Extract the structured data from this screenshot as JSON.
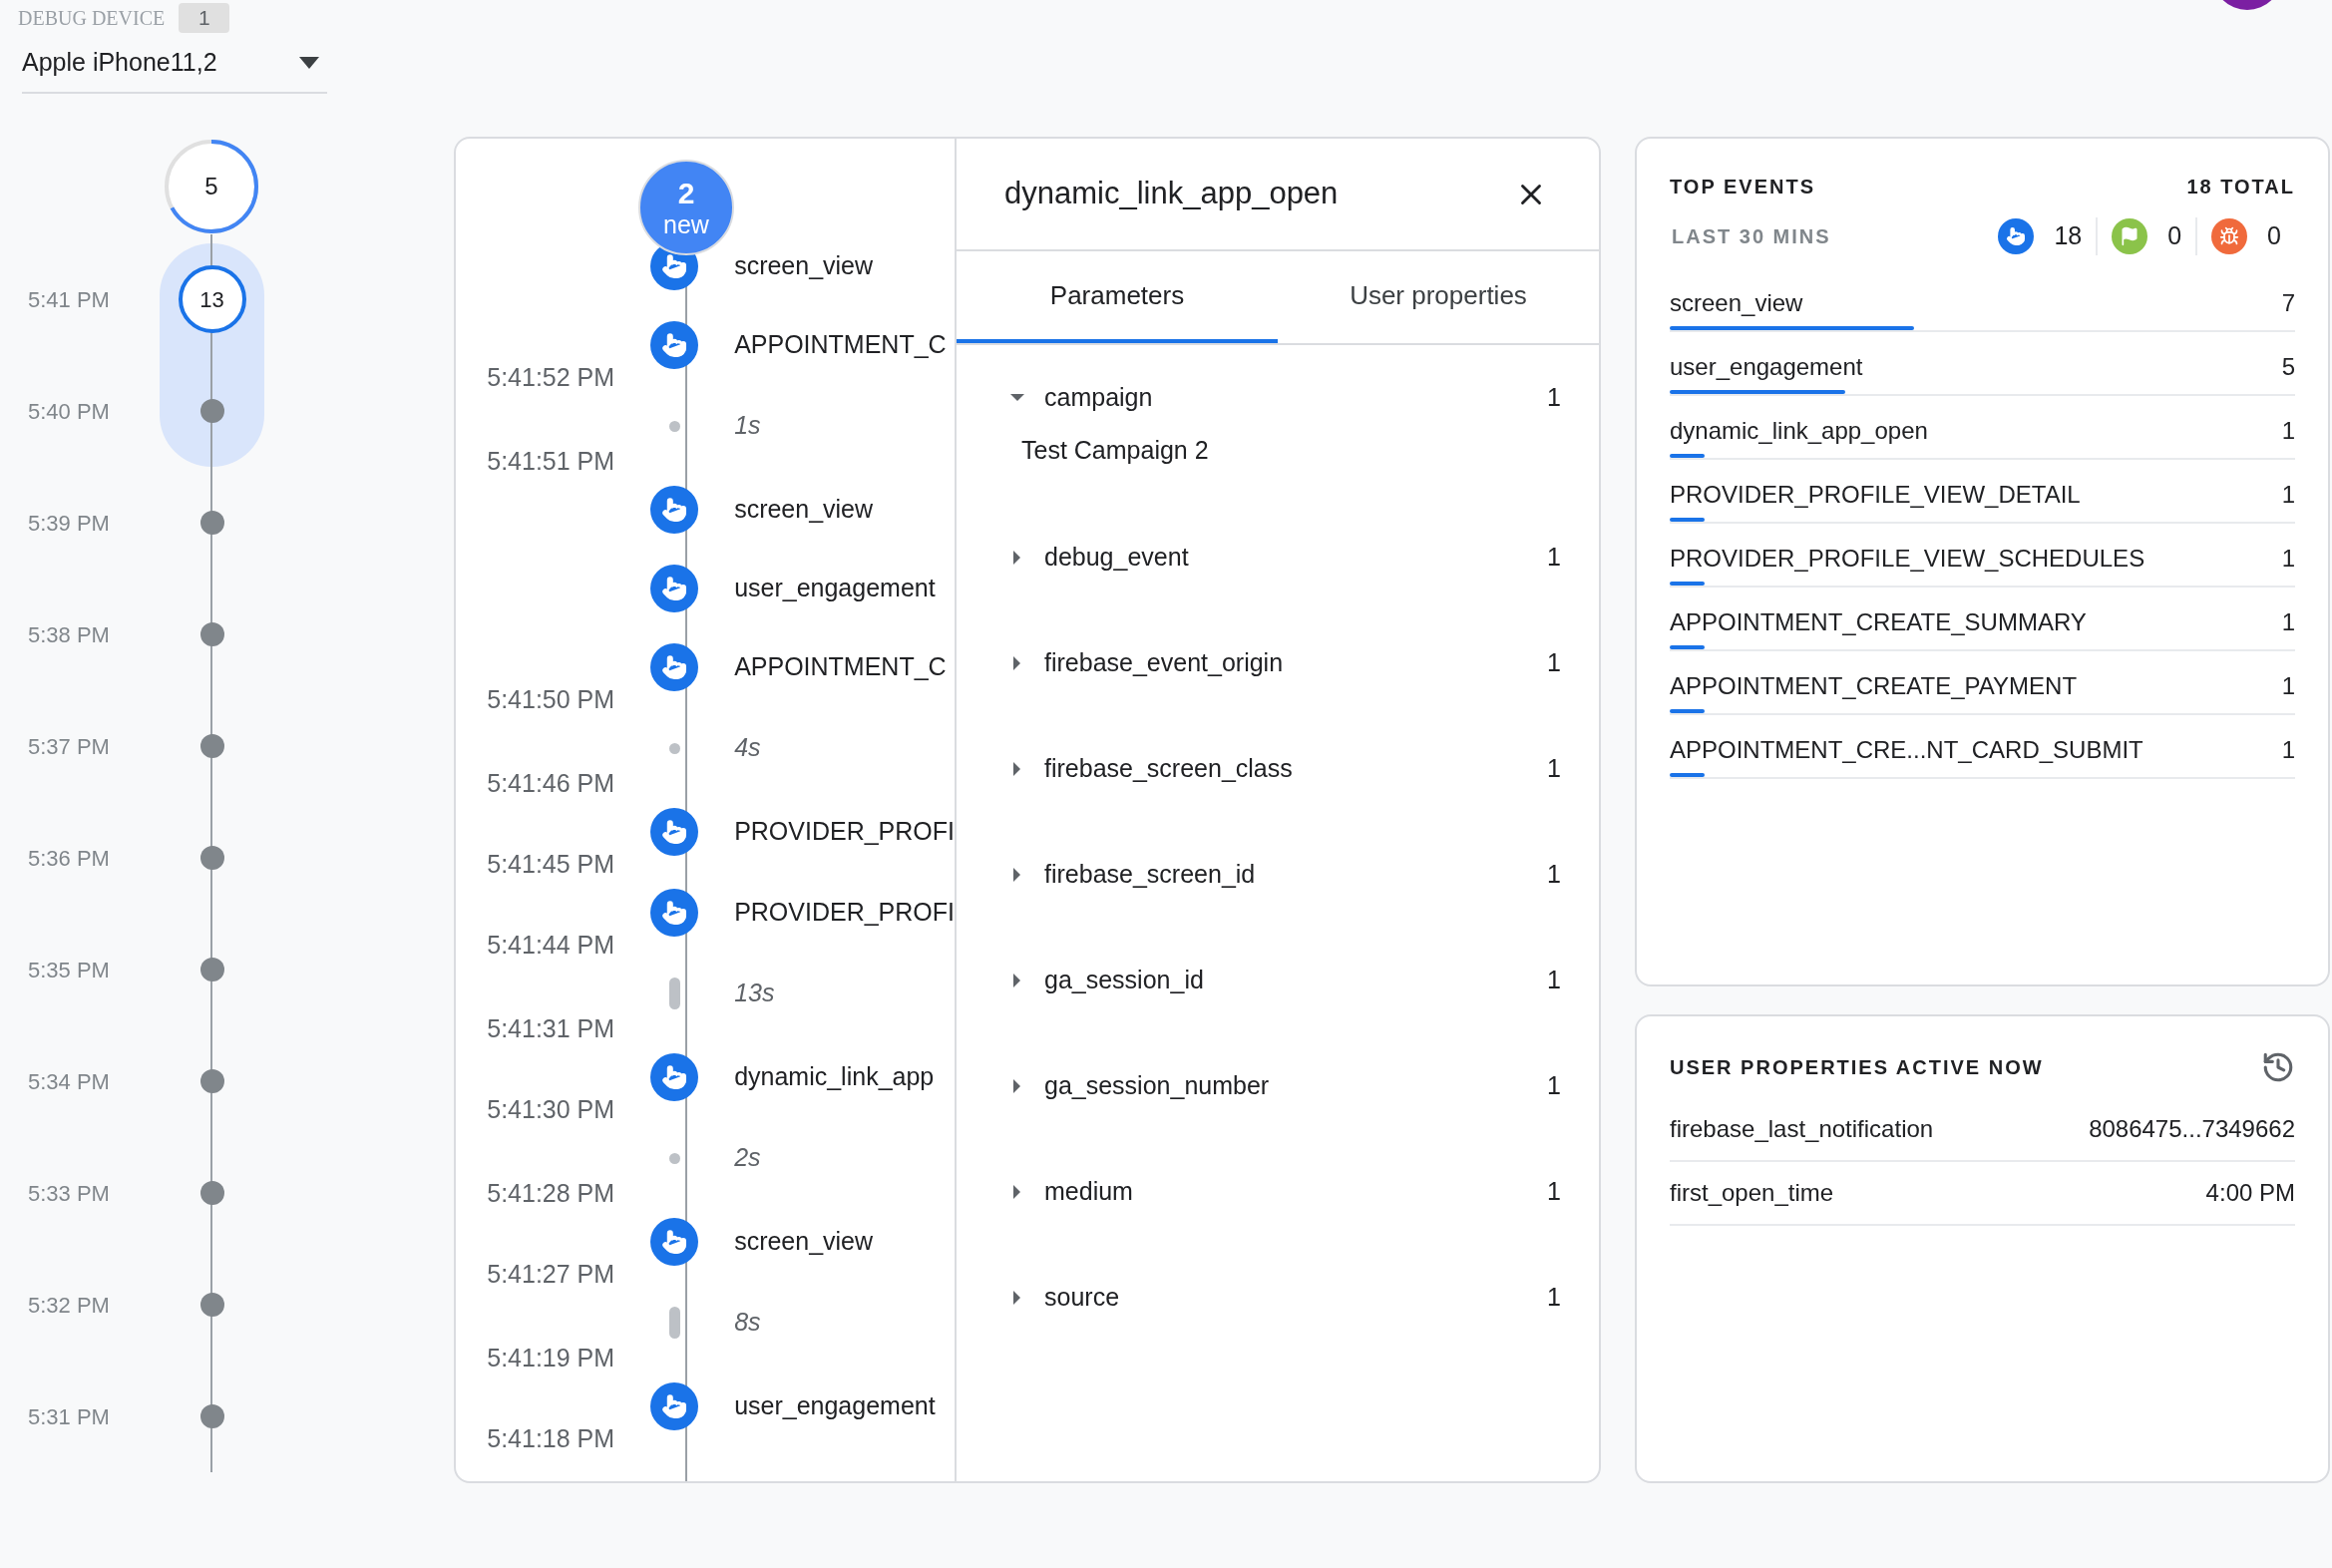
{
  "debug_device": {
    "label": "DEBUG DEVICE",
    "count": "1",
    "device": "Apple iPhone11,2"
  },
  "timeline": {
    "pending": {
      "count": "5",
      "level": 0.67
    },
    "minutes": [
      {
        "time": "5:41 PM",
        "kind": "count",
        "count": "13",
        "in_range": true
      },
      {
        "time": "5:40 PM",
        "kind": "dot",
        "in_range": true
      },
      {
        "time": "5:39 PM",
        "kind": "dot",
        "in_range": false
      },
      {
        "time": "5:38 PM",
        "kind": "dot",
        "in_range": false
      },
      {
        "time": "5:37 PM",
        "kind": "dot",
        "in_range": false
      },
      {
        "time": "5:36 PM",
        "kind": "dot",
        "in_range": false
      },
      {
        "time": "5:35 PM",
        "kind": "dot",
        "in_range": false
      },
      {
        "time": "5:34 PM",
        "kind": "dot",
        "in_range": false
      },
      {
        "time": "5:33 PM",
        "kind": "dot",
        "in_range": false
      },
      {
        "time": "5:32 PM",
        "kind": "dot",
        "in_range": false
      },
      {
        "time": "5:31 PM",
        "kind": "dot",
        "in_range": false
      }
    ]
  },
  "stream": {
    "new_badge": {
      "count": "2",
      "label": "new"
    },
    "items": [
      {
        "kind": "event",
        "name": "screen_view"
      },
      {
        "kind": "event",
        "name": "APPOINTMENT_C"
      },
      {
        "kind": "time",
        "time": "5:41:52 PM"
      },
      {
        "kind": "gap",
        "duration": "1s",
        "long": false
      },
      {
        "kind": "time",
        "time": "5:41:51 PM"
      },
      {
        "kind": "event",
        "name": "screen_view"
      },
      {
        "kind": "event",
        "name": "user_engagement"
      },
      {
        "kind": "event",
        "name": "APPOINTMENT_C"
      },
      {
        "kind": "time",
        "time": "5:41:50 PM"
      },
      {
        "kind": "gap",
        "duration": "4s",
        "long": false
      },
      {
        "kind": "time",
        "time": "5:41:46 PM"
      },
      {
        "kind": "event",
        "name": "PROVIDER_PROFI"
      },
      {
        "kind": "time",
        "time": "5:41:45 PM"
      },
      {
        "kind": "event",
        "name": "PROVIDER_PROFI"
      },
      {
        "kind": "time",
        "time": "5:41:44 PM"
      },
      {
        "kind": "gap",
        "duration": "13s",
        "long": true
      },
      {
        "kind": "time",
        "time": "5:41:31 PM"
      },
      {
        "kind": "event",
        "name": "dynamic_link_app"
      },
      {
        "kind": "time",
        "time": "5:41:30 PM"
      },
      {
        "kind": "gap",
        "duration": "2s",
        "long": false
      },
      {
        "kind": "time",
        "time": "5:41:28 PM"
      },
      {
        "kind": "event",
        "name": "screen_view"
      },
      {
        "kind": "time",
        "time": "5:41:27 PM"
      },
      {
        "kind": "gap",
        "duration": "8s",
        "long": true
      },
      {
        "kind": "time",
        "time": "5:41:19 PM"
      },
      {
        "kind": "event",
        "name": "user_engagement"
      },
      {
        "kind": "time",
        "time": "5:41:18 PM"
      }
    ]
  },
  "details": {
    "title": "dynamic_link_app_open",
    "tabs": [
      {
        "label": "Parameters",
        "selected": true
      },
      {
        "label": "User properties",
        "selected": false
      }
    ],
    "parameters": [
      {
        "name": "campaign",
        "count": "1",
        "expanded": true,
        "value": "Test Campaign 2"
      },
      {
        "name": "debug_event",
        "count": "1",
        "expanded": false
      },
      {
        "name": "firebase_event_origin",
        "count": "1",
        "expanded": false
      },
      {
        "name": "firebase_screen_class",
        "count": "1",
        "expanded": false
      },
      {
        "name": "firebase_screen_id",
        "count": "1",
        "expanded": false
      },
      {
        "name": "ga_session_id",
        "count": "1",
        "expanded": false
      },
      {
        "name": "ga_session_number",
        "count": "1",
        "expanded": false
      },
      {
        "name": "medium",
        "count": "1",
        "expanded": false
      },
      {
        "name": "source",
        "count": "1",
        "expanded": false
      }
    ]
  },
  "top_events": {
    "title": "TOP EVENTS",
    "total": "18 TOTAL",
    "period": "LAST 30 MINS",
    "stats": [
      {
        "kind": "event",
        "count": "18",
        "color": "#1a73e8"
      },
      {
        "kind": "conversion",
        "count": "0",
        "color": "#8bc34a"
      },
      {
        "kind": "error",
        "count": "0",
        "color": "#f06a3c"
      }
    ],
    "events": [
      {
        "name": "screen_view",
        "count": "7",
        "level": 0.39
      },
      {
        "name": "user_engagement",
        "count": "5",
        "level": 0.28
      },
      {
        "name": "dynamic_link_app_open",
        "count": "1",
        "level": 0.056
      },
      {
        "name": "PROVIDER_PROFILE_VIEW_DETAIL",
        "count": "1",
        "level": 0.056
      },
      {
        "name": "PROVIDER_PROFILE_VIEW_SCHEDULES",
        "count": "1",
        "level": 0.056
      },
      {
        "name": "APPOINTMENT_CREATE_SUMMARY",
        "count": "1",
        "level": 0.056
      },
      {
        "name": "APPOINTMENT_CREATE_PAYMENT",
        "count": "1",
        "level": 0.056
      },
      {
        "name": "APPOINTMENT_CRE...NT_CARD_SUBMIT",
        "count": "1",
        "level": 0.056
      }
    ]
  },
  "user_properties": {
    "title": "USER PROPERTIES ACTIVE NOW",
    "rows": [
      {
        "name": "firebase_last_notification",
        "value": "8086475...7349662"
      },
      {
        "name": "first_open_time",
        "value": "4:00 PM"
      }
    ]
  }
}
